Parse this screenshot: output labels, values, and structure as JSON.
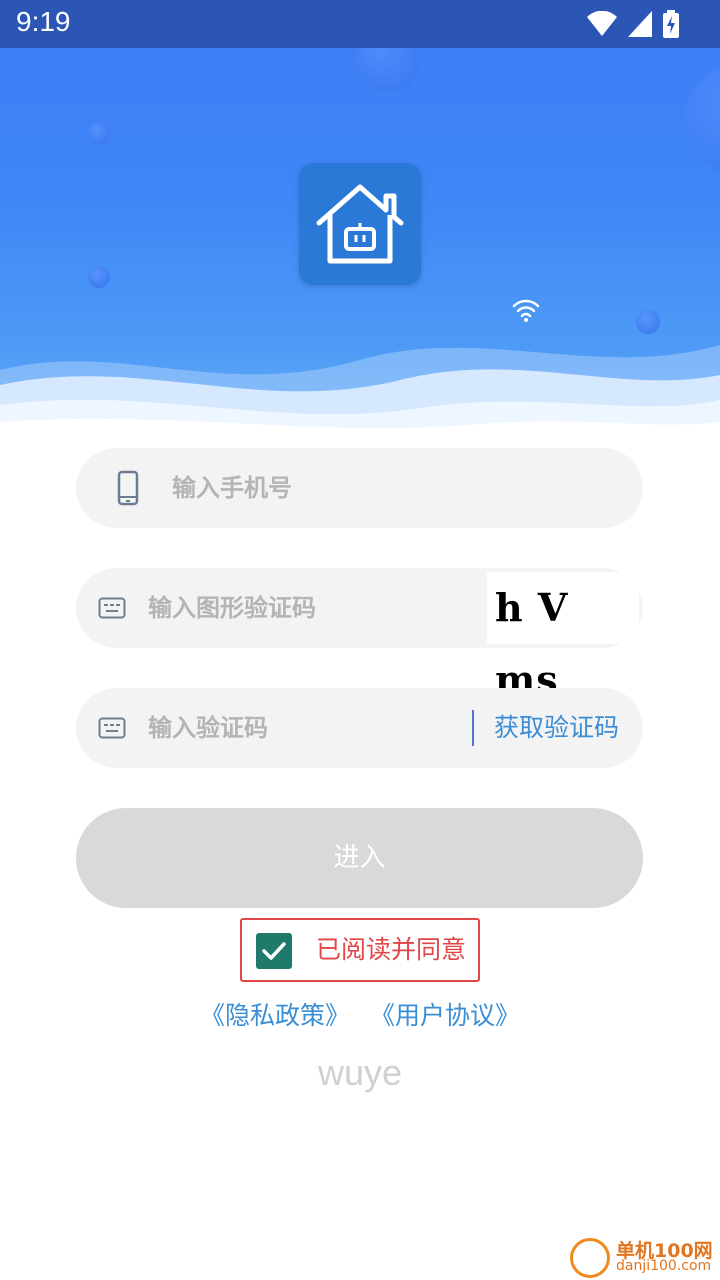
{
  "status_bar": {
    "time": "9:19"
  },
  "form": {
    "phone_placeholder": "输入手机号",
    "captcha_placeholder": "输入图形验证码",
    "captcha_image_text": "h V ms",
    "sms_placeholder": "输入验证码",
    "get_code_label": "获取验证码",
    "enter_label": "进入"
  },
  "agreement": {
    "checked": true,
    "text": "已阅读并同意",
    "privacy_link": "《隐私政策》",
    "terms_link": "《用户协议》"
  },
  "brand_text": "wuye",
  "watermark": {
    "line1": "单机100网",
    "line2": "danji100.com"
  },
  "colors": {
    "header_blue": "#3d7cf7",
    "link_blue": "#3a8ed6",
    "agree_red": "#e24646",
    "checkbox_green": "#1f7a6c"
  }
}
